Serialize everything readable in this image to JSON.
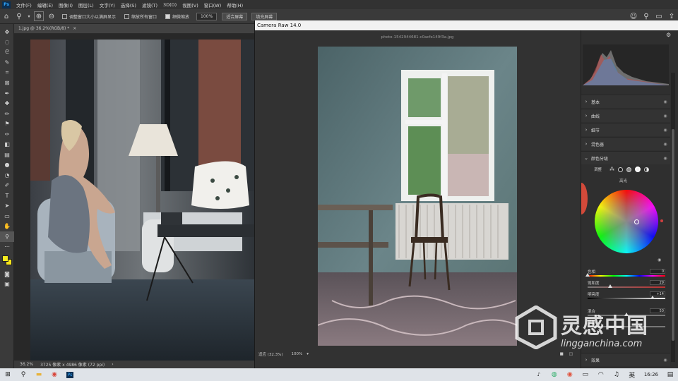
{
  "menubar": {
    "logo": "Ps",
    "items": [
      "文件(F)",
      "编辑(E)",
      "图像(I)",
      "图层(L)",
      "文字(Y)",
      "选择(S)",
      "滤镜(T)",
      "3D(D)",
      "视图(V)",
      "窗口(W)",
      "帮助(H)"
    ]
  },
  "options": {
    "resize_window": "调整窗口大小以满屏显示",
    "zoom_all": "缩放所有窗口",
    "scrubby_zoom": "细微缩放",
    "zoom_value": "100%",
    "fit_screen": "适合屏幕",
    "fill_screen": "填充屏幕"
  },
  "document": {
    "tab_title": "1.jpg @ 36.2%(RGB/8) *",
    "close": "×",
    "zoom": "36.2%",
    "size_info": "3725 像素 x 4986 像素 (72 ppi)"
  },
  "camera_raw": {
    "title": "Camera Raw 14.0",
    "filename": "photo-1542944681-c0acfe149f3a.jpg",
    "bottom_fit": "适应 (32.3%)",
    "bottom_zoom": "100%",
    "sections": [
      {
        "label": "基本"
      },
      {
        "label": "曲线"
      },
      {
        "label": "细节"
      },
      {
        "label": "混色器"
      }
    ],
    "color_grading": {
      "label": "颜色分级",
      "adjust": "调整",
      "wheel_label": "高光",
      "sliders": [
        {
          "label": "色相",
          "value": "0"
        },
        {
          "label": "饱和度",
          "value": "29"
        },
        {
          "label": "明亮度",
          "value": "+14"
        },
        {
          "label": "混合",
          "value": "50"
        },
        {
          "label": "平衡",
          "value": ""
        }
      ]
    },
    "effects": "效果"
  },
  "taskbar": {
    "time": "16:26",
    "ime": "英"
  },
  "watermark": {
    "cn": "灵感中国",
    "en": "lingganchina.com"
  }
}
